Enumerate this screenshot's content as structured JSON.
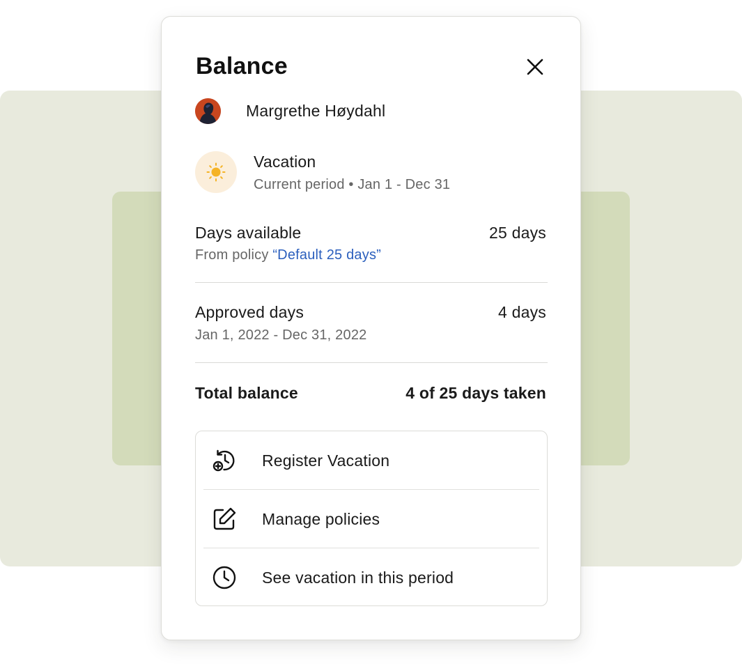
{
  "dialog": {
    "title": "Balance"
  },
  "employee": {
    "name": "Margrethe Høydahl"
  },
  "leave_type": {
    "label": "Vacation",
    "period": "Current period • Jan 1 - Dec 31"
  },
  "days_available": {
    "label": "Days available",
    "value": "25 days",
    "source_prefix": "From policy ",
    "policy_name": "“Default 25 days”"
  },
  "approved_days": {
    "label": "Approved days",
    "value": "4 days",
    "range": "Jan 1, 2022 - Dec 31, 2022"
  },
  "total_balance": {
    "label": "Total balance",
    "value": "4 of 25 days taken"
  },
  "actions": [
    {
      "label": "Register Vacation",
      "icon": "history-plus-icon"
    },
    {
      "label": "Manage policies",
      "icon": "edit-icon"
    },
    {
      "label": "See vacation in this period",
      "icon": "clock-icon"
    }
  ],
  "colors": {
    "link": "#2b5fbd",
    "sun_bg": "#fbeedb",
    "sun": "#f5b325",
    "bg_outer": "#e8eadd",
    "bg_inner": "#d3dbba"
  }
}
